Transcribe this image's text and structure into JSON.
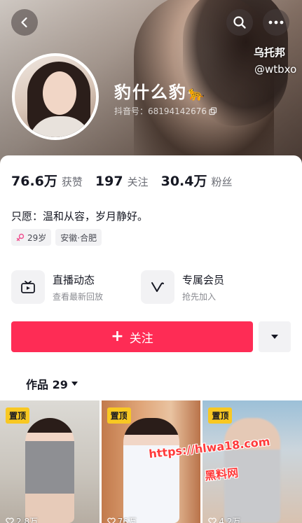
{
  "header": {
    "watermark_name": "乌托邦",
    "watermark_handle": "@wtbxo",
    "nickname": "豹什么豹",
    "nickname_emoji": "🐆",
    "douyin_id": "抖音号：68194142676",
    "icons": {
      "back": "back-arrow-icon",
      "search": "search-icon",
      "more": "more-icon",
      "copy": "copy-icon"
    }
  },
  "stats": [
    {
      "value": "76.6万",
      "label": "获赞"
    },
    {
      "value": "197",
      "label": "关注"
    },
    {
      "value": "30.4万",
      "label": "粉丝"
    }
  ],
  "bio": "只愿：温和从容，岁月静好。",
  "tags": {
    "age": "29岁",
    "location": "安徽·合肥"
  },
  "features": {
    "live": {
      "title": "直播动态",
      "subtitle": "查看最新回放",
      "icon": "tv-icon"
    },
    "member": {
      "title": "专属会员",
      "subtitle": "抢先加入",
      "icon": "v-badge-icon"
    }
  },
  "actions": {
    "follow_plus": "+",
    "follow_label": "关注"
  },
  "works": {
    "tab_label": "作品 29",
    "items": [
      {
        "badge": "置顶",
        "stat": "2.8万"
      },
      {
        "badge": "置顶",
        "stat": "76万"
      },
      {
        "badge": "置顶",
        "stat": "4.2万"
      }
    ]
  },
  "overlay": {
    "site_url": "https://hlwa18.com",
    "site_name": "黑料网"
  },
  "colors": {
    "accent": "#fe2c55",
    "pin_badge": "#f8c822",
    "watermark": "#ff3b3b"
  }
}
